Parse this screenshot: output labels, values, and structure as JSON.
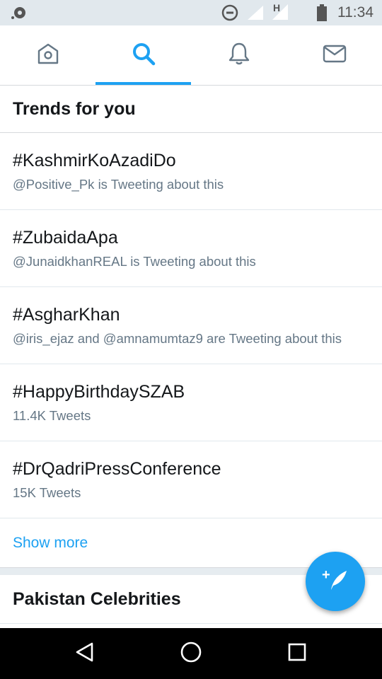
{
  "status_bar": {
    "time": "11:34",
    "network_letter": "H",
    "icons": [
      "cast-icon",
      "do-not-disturb-icon",
      "signal-icon",
      "network-h-icon",
      "battery-icon"
    ]
  },
  "tabs": [
    {
      "name": "home",
      "icon": "home-icon",
      "active": false
    },
    {
      "name": "search",
      "icon": "search-icon",
      "active": true
    },
    {
      "name": "notifications",
      "icon": "bell-icon",
      "active": false
    },
    {
      "name": "messages",
      "icon": "mail-icon",
      "active": false
    }
  ],
  "trends_section": {
    "title": "Trends for you",
    "items": [
      {
        "name": "#KashmirKoAzadiDo",
        "meta": "@Positive_Pk is Tweeting about this"
      },
      {
        "name": "#ZubaidaApa",
        "meta": "@JunaidkhanREAL is Tweeting about this"
      },
      {
        "name": "#AsgharKhan",
        "meta": "@iris_ejaz and @amnamumtaz9 are Tweeting about this"
      },
      {
        "name": "#HappyBirthdaySZAB",
        "meta": "11.4K Tweets"
      },
      {
        "name": "#DrQadriPressConference",
        "meta": "15K Tweets"
      }
    ],
    "show_more": "Show more"
  },
  "celebrities_section": {
    "title": "Pakistan Celebrities"
  },
  "fab": {
    "icon": "compose-tweet-icon",
    "symbol": "+"
  },
  "nav_bar": {
    "buttons": [
      "back-icon",
      "home-circle-icon",
      "recents-icon"
    ]
  },
  "colors": {
    "accent": "#1da1f2",
    "text": "#14171a",
    "secondary_text": "#657786",
    "status_bar_bg": "#e1e8ed",
    "divider": "#e1e8ed"
  }
}
